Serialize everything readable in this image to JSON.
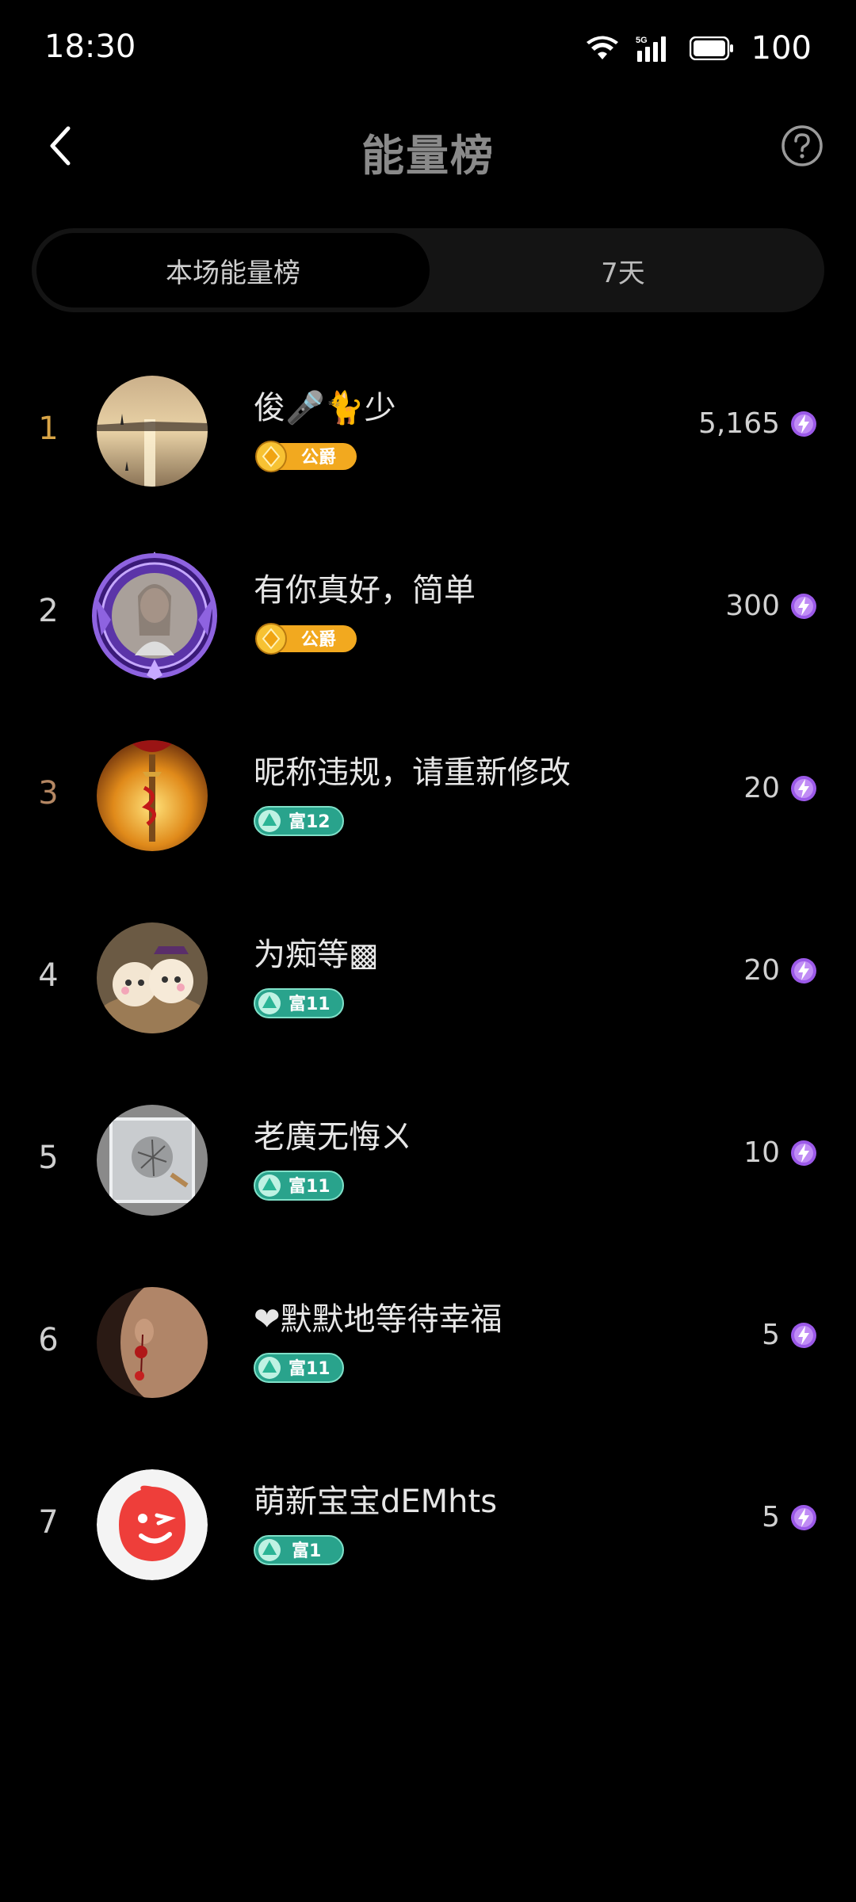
{
  "status": {
    "time": "18:30",
    "battery": "100",
    "network": "5G"
  },
  "header": {
    "title": "能量榜"
  },
  "tabs": [
    {
      "label": "本场能量榜",
      "active": true
    },
    {
      "label": "7天",
      "active": false
    }
  ],
  "colors": {
    "gold": "#d8a447",
    "bronze": "#b48763",
    "badge_teal": "#29a38c",
    "badge_gold": "#f2a91f",
    "bolt": "#9b59e8"
  },
  "ranking": [
    {
      "rank": "1",
      "name": "俊🎤🐈少",
      "badge": "公爵",
      "badge_type": "duke",
      "score": "5,165"
    },
    {
      "rank": "2",
      "name": "有你真好，简单",
      "badge": "公爵",
      "badge_type": "duke",
      "score": "300"
    },
    {
      "rank": "3",
      "name": "昵称违规，请重新修改",
      "badge": "富12",
      "badge_type": "rich",
      "score": "20"
    },
    {
      "rank": "4",
      "name": "为痴等▩",
      "badge": "富11",
      "badge_type": "rich",
      "score": "20"
    },
    {
      "rank": "5",
      "name": "老廣无悔ㄨ",
      "badge": "富11",
      "badge_type": "rich",
      "score": "10"
    },
    {
      "rank": "6",
      "name": "❤默默地等待幸福",
      "badge": "富11",
      "badge_type": "rich",
      "score": "5"
    },
    {
      "rank": "7",
      "name": "萌新宝宝dEMhts",
      "badge": "富1",
      "badge_type": "rich",
      "score": "5"
    }
  ]
}
